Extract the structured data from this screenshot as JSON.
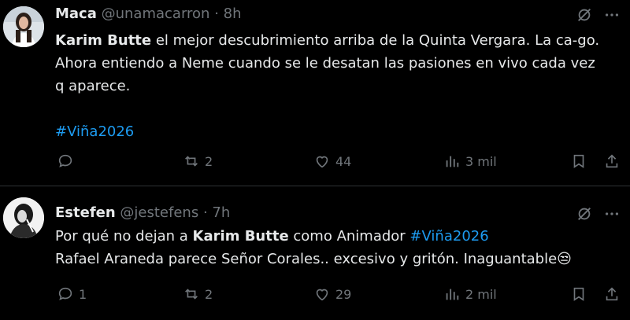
{
  "tweets": [
    {
      "name": "Maca",
      "handle": "@unamacarron",
      "separator": "·",
      "time": "8h",
      "text_bold": "Karim Butte",
      "text_line1_rest": " el mejor descubrimiento arriba de la Quinta Vergara. La ca-go.",
      "text_line2": "Ahora entiendo a Neme cuando se le desatan las pasiones en vivo cada vez",
      "text_line3": "q aparece.",
      "hashtag": "#Viña2026",
      "replies": "",
      "retweets": "2",
      "likes": "44",
      "views": "3 mil"
    },
    {
      "name": "Estefen",
      "handle": "@jestefens",
      "separator": "·",
      "time": "7h",
      "text_prefix": "Por qué no dejan a ",
      "text_bold": "Karim Butte",
      "text_mid": " como Animador ",
      "hashtag": "#Viña2026",
      "text_line2": "Rafael Araneda parece Señor Corales.. excesivo y gritón. Inaguantable",
      "emoji": "😒",
      "replies": "1",
      "retweets": "2",
      "likes": "29",
      "views": "2 mil"
    }
  ],
  "icons": {
    "grok": "grok-icon",
    "more": "more-icon",
    "reply": "reply-icon",
    "retweet": "retweet-icon",
    "like": "like-icon",
    "views": "views-icon",
    "bookmark": "bookmark-icon",
    "share": "share-icon"
  },
  "colors": {
    "background": "#000000",
    "text": "#e7e9ea",
    "secondary": "#71767b",
    "link": "#1d9bf0",
    "divider": "#2f3336"
  }
}
